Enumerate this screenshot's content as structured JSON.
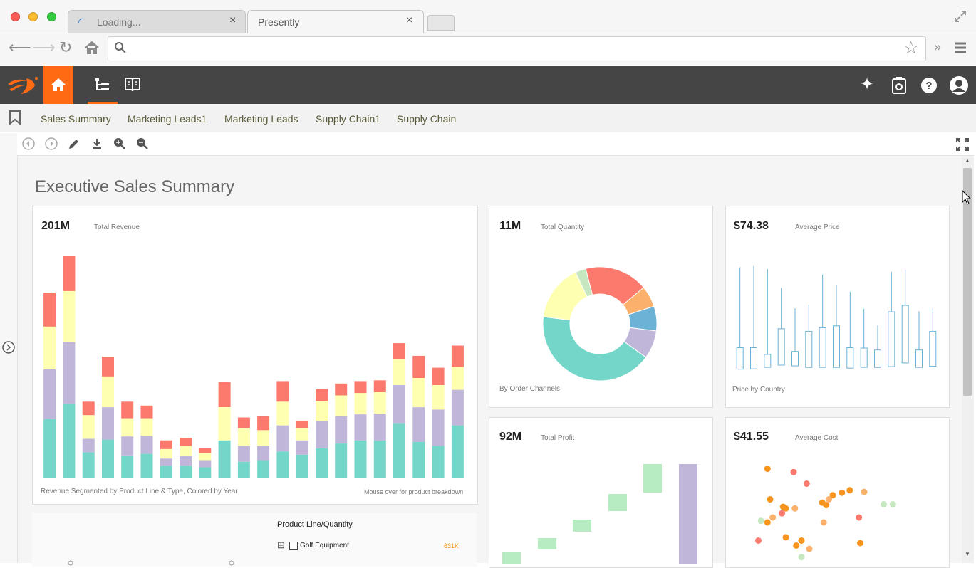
{
  "browser": {
    "tabs": [
      {
        "label": "Loading..."
      },
      {
        "label": "Presently"
      }
    ],
    "close_glyph": "×",
    "overflow_glyph": "»"
  },
  "app": {
    "colors": {
      "accent": "#ff6a13",
      "header_bg": "#454545"
    },
    "icons": [
      "logo-icon",
      "home-icon",
      "tree-icon",
      "book-icon",
      "sparkle-icon",
      "dashboard-settings-icon",
      "help-icon",
      "user-icon"
    ]
  },
  "viewsheet_tabs": [
    "Sales Summary",
    "Marketing Leads1",
    "Marketing Leads",
    "Supply Chain1",
    "Supply Chain"
  ],
  "dashboard": {
    "title": "Executive Sales Summary",
    "revenue": {
      "value": "201M",
      "label": "Total Revenue",
      "footer_left": "Revenue Segmented by Product Line & Type, Colored by Year",
      "footer_right": "Mouse over for product breakdown"
    },
    "quantity": {
      "value": "11M",
      "label": "Total Quantity",
      "footer": "By Order Channels"
    },
    "price": {
      "value": "$74.38",
      "label": "Average Price",
      "footer": "Price by Country"
    },
    "profit": {
      "value": "92M",
      "label": "Total Profit"
    },
    "cost": {
      "value": "$41.55",
      "label": "Average Cost"
    },
    "product_table": {
      "header": "Product Line/Quantity",
      "rows": [
        {
          "expander": "⊞",
          "label": "Golf Equipment",
          "value": "631K"
        }
      ]
    }
  },
  "chart_data": [
    {
      "type": "bar",
      "stacked": true,
      "colors": [
        "#74d6c8",
        "#c0b6da",
        "#feffb0",
        "#fb7a6d"
      ],
      "series": [
        {
          "values": [
            75,
            94,
            33,
            49,
            29,
            31,
            16,
            16,
            14,
            48,
            21,
            23,
            34,
            30,
            38,
            44,
            48,
            48,
            70,
            46,
            41,
            67
          ]
        },
        {
          "values": [
            63,
            78,
            17,
            41,
            24,
            23,
            9,
            12,
            9,
            0,
            20,
            18,
            33,
            18,
            35,
            35,
            33,
            34,
            48,
            44,
            46,
            45
          ]
        },
        {
          "values": [
            54,
            65,
            30,
            39,
            23,
            22,
            12,
            13,
            9,
            42,
            22,
            20,
            30,
            15,
            25,
            26,
            27,
            27,
            33,
            37,
            31,
            29
          ]
        },
        {
          "values": [
            43,
            44,
            17,
            25,
            21,
            16,
            11,
            10,
            6,
            32,
            14,
            18,
            26,
            10,
            15,
            15,
            15,
            15,
            20,
            28,
            22,
            27
          ]
        }
      ],
      "ylim": [
        0,
        290
      ]
    },
    {
      "type": "pie",
      "donut": true,
      "colors": [
        "#74d6c8",
        "#feffb0",
        "#c6e7c0",
        "#fb7a6d",
        "#fbb06b",
        "#6cb1d6",
        "#c0b6da"
      ],
      "values": [
        42,
        16,
        3,
        18,
        6,
        7,
        8
      ]
    },
    {
      "type": "box",
      "categories": 15,
      "boxes": [
        {
          "low": 62,
          "q1": 35,
          "q3": 93,
          "high": 310
        },
        {
          "low": 61,
          "q1": 36,
          "q3": 93,
          "high": 313
        },
        {
          "low": 60,
          "q1": 40,
          "q3": 75,
          "high": 305
        },
        {
          "low": 76,
          "q1": 46,
          "q3": 144,
          "high": 254
        },
        {
          "low": 72,
          "q1": 44,
          "q3": 83,
          "high": 199
        },
        {
          "low": 57,
          "q1": 40,
          "q3": 137,
          "high": 209
        },
        {
          "low": 71,
          "q1": 40,
          "q3": 147,
          "high": 290
        },
        {
          "low": 71,
          "q1": 40,
          "q3": 152,
          "high": 263
        },
        {
          "low": 64,
          "q1": 38,
          "q3": 93,
          "high": 244
        },
        {
          "low": 55,
          "q1": 40,
          "q3": 92,
          "high": 198
        },
        {
          "low": 69,
          "q1": 40,
          "q3": 87,
          "high": 153
        },
        {
          "low": 53,
          "q1": 42,
          "q3": 190,
          "high": 298
        },
        {
          "low": 76,
          "q1": 52,
          "q3": 207,
          "high": 304
        },
        {
          "low": 55,
          "q1": 40,
          "q3": 87,
          "high": 191
        },
        {
          "low": 60,
          "q1": 43,
          "q3": 137,
          "high": 198
        }
      ],
      "ylim": [
        0,
        330
      ],
      "color": "#6cb1d6"
    },
    {
      "type": "waterfall",
      "colors": [
        "#b7ecc2",
        "#c0b6da"
      ],
      "steps": [
        {
          "base": 0,
          "height": 16
        },
        {
          "base": 20,
          "height": 16
        },
        {
          "base": 45,
          "height": 17
        },
        {
          "base": 74,
          "height": 24
        },
        {
          "base": 100,
          "height": 40
        },
        {
          "base": 0,
          "height": 140,
          "total": true
        }
      ]
    },
    {
      "type": "scatter",
      "points": [
        {
          "x": 1,
          "y": 135,
          "c": "#f7941d"
        },
        {
          "x": 3,
          "y": 131,
          "c": "#fb7a6d"
        },
        {
          "x": 4,
          "y": 117,
          "c": "#fb7a6d"
        },
        {
          "x": 1.2,
          "y": 98,
          "c": "#f7941d"
        },
        {
          "x": 6,
          "y": 103,
          "c": "#f7941d"
        },
        {
          "x": 6.7,
          "y": 106,
          "c": "#f7941d"
        },
        {
          "x": 7.3,
          "y": 109,
          "c": "#f7941d"
        },
        {
          "x": 8.4,
          "y": 107,
          "c": "#fbb06b"
        },
        {
          "x": 9.9,
          "y": 92,
          "c": "#c6e7c0"
        },
        {
          "x": 10.6,
          "y": 92,
          "c": "#c6e7c0"
        },
        {
          "x": 5.7,
          "y": 98,
          "c": "#fbb06b"
        },
        {
          "x": 5.2,
          "y": 94,
          "c": "#f7941d"
        },
        {
          "x": 5.5,
          "y": 91,
          "c": "#f7941d"
        },
        {
          "x": 2.4,
          "y": 87,
          "c": "#f7941d"
        },
        {
          "x": 2.2,
          "y": 89,
          "c": "#f7941d"
        },
        {
          "x": 3.1,
          "y": 87,
          "c": "#fbb06b"
        },
        {
          "x": 2.1,
          "y": 81,
          "c": "#fb7a6d"
        },
        {
          "x": 1,
          "y": 70,
          "c": "#f7941d"
        },
        {
          "x": 0.5,
          "y": 72,
          "c": "#c6e7c0"
        },
        {
          "x": 1.4,
          "y": 76,
          "c": "#fbb06b"
        },
        {
          "x": 5.3,
          "y": 70,
          "c": "#fbb06b"
        },
        {
          "x": 8,
          "y": 76,
          "c": "#fb7a6d"
        },
        {
          "x": 0.3,
          "y": 48,
          "c": "#fb7a6d"
        },
        {
          "x": 2.4,
          "y": 52,
          "c": "#f7941d"
        },
        {
          "x": 3.6,
          "y": 48,
          "c": "#f7941d"
        },
        {
          "x": 3.2,
          "y": 42,
          "c": "#f7941d"
        },
        {
          "x": 4.2,
          "y": 38,
          "c": "#fbb06b"
        },
        {
          "x": 3.6,
          "y": 28,
          "c": "#c6e7c0"
        },
        {
          "x": 8.1,
          "y": 45,
          "c": "#f7941d"
        }
      ],
      "xlim": [
        0,
        12
      ],
      "ylim": [
        20,
        145
      ]
    }
  ]
}
